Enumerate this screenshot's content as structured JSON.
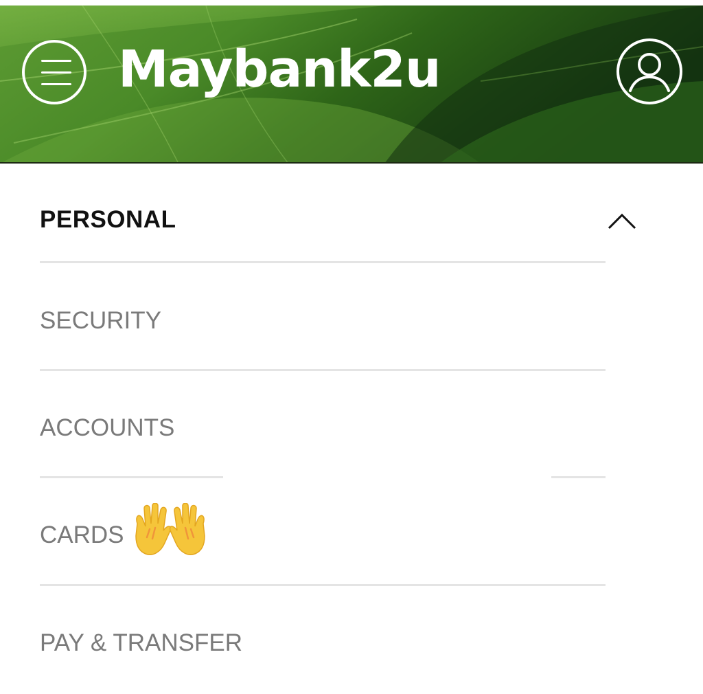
{
  "header": {
    "brand": "Maybank2u",
    "menu_icon": "hamburger-menu-icon",
    "profile_icon": "user-profile-icon",
    "colors": {
      "leaf_dark": "#1f4512",
      "leaf_mid": "#3f7d22",
      "leaf_light": "#78b342",
      "text": "#ffffff"
    }
  },
  "nav": {
    "section": {
      "label": "PERSONAL",
      "expanded": true,
      "toggle_icon": "chevron-up-icon"
    },
    "items": [
      {
        "label": "SECURITY"
      },
      {
        "label": "ACCOUNTS"
      },
      {
        "label": "CARDS",
        "emoji": "raised-hands-emoji"
      },
      {
        "label": "PAY & TRANSFER"
      }
    ],
    "colors": {
      "active_label": "#111111",
      "label": "#7a7a7a",
      "divider": "#e4e4e4"
    }
  }
}
